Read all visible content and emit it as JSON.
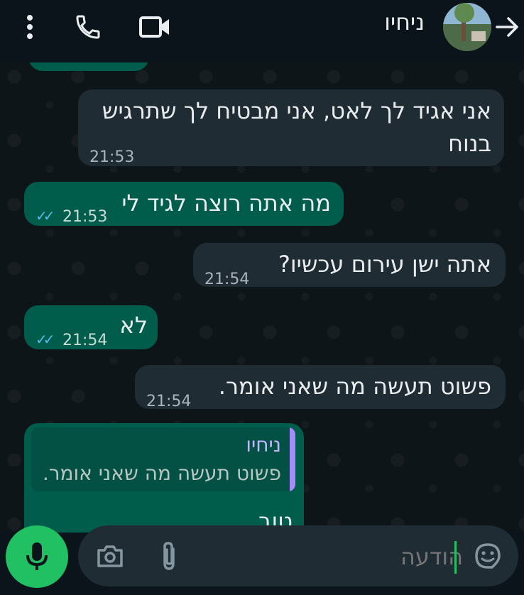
{
  "header": {
    "contact_name": "ניחיו",
    "icons": [
      "back-arrow-icon",
      "avatar",
      "video-call-icon",
      "phone-icon",
      "more-icon"
    ]
  },
  "messages": [
    {
      "direction": "incoming",
      "text_line1": "אני אגיד לך לאט, אני מבטיח לך שתרגיש",
      "text_line2": "בנוח",
      "time": "21:53"
    },
    {
      "direction": "outgoing",
      "text": "מה אתה רוצה לגיד לי",
      "time": "21:53",
      "status": "read"
    },
    {
      "direction": "incoming",
      "text": "אתה ישן עירום עכשיו?",
      "time": "21:54"
    },
    {
      "direction": "outgoing",
      "text": "לא",
      "time": "21:54",
      "status": "read"
    },
    {
      "direction": "incoming",
      "text": "פשוט תעשה מה שאני אומר.",
      "time": "21:54"
    },
    {
      "direction": "outgoing",
      "quote_author": "ניחיו",
      "quote_text": "פשוט תעשה מה שאני אומר.",
      "text_partial": "טוב"
    }
  ],
  "composer": {
    "placeholder": "הודעה",
    "icons": [
      "emoji-icon",
      "attach-icon",
      "camera-icon",
      "mic-icon"
    ]
  },
  "colors": {
    "incoming_bubble": "#202c33",
    "outgoing_bubble": "#005c4b",
    "accent_green": "#21c063",
    "read_tick": "#53bdeb",
    "quote_bar": "#a78bfa"
  }
}
